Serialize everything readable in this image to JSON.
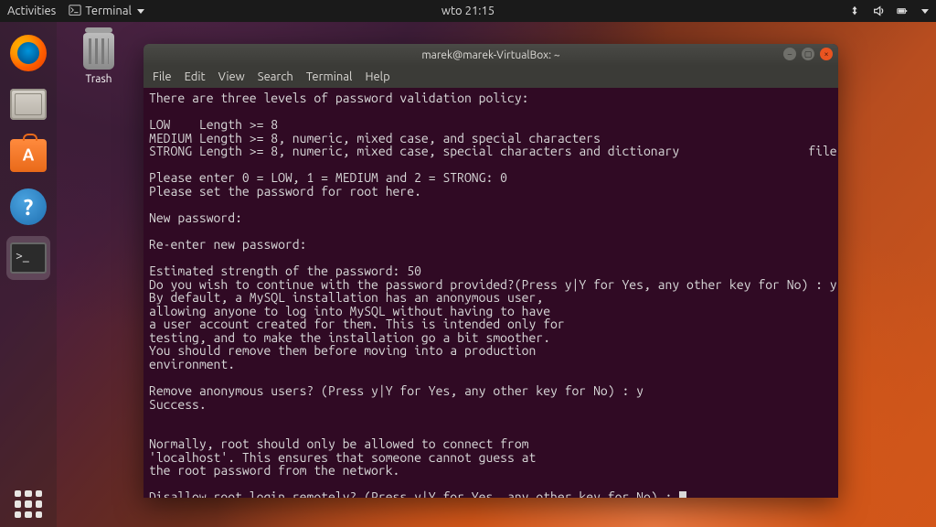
{
  "topbar": {
    "activities": "Activities",
    "app_indicator": "Terminal",
    "clock": "wto 21:15"
  },
  "desktop": {
    "trash_label": "Trash"
  },
  "launcher": {
    "items": [
      "firefox",
      "files",
      "software",
      "help",
      "terminal"
    ]
  },
  "window": {
    "title": "marek@marek-VirtualBox: ~",
    "menus": {
      "file": "File",
      "edit": "Edit",
      "view": "View",
      "search": "Search",
      "terminal": "Terminal",
      "help": "Help"
    }
  },
  "terminal_lines": [
    "There are three levels of password validation policy:",
    "",
    "LOW    Length >= 8",
    "MEDIUM Length >= 8, numeric, mixed case, and special characters",
    "STRONG Length >= 8, numeric, mixed case, special characters and dictionary                  file",
    "",
    "Please enter 0 = LOW, 1 = MEDIUM and 2 = STRONG: 0",
    "Please set the password for root here.",
    "",
    "New password:",
    "",
    "Re-enter new password:",
    "",
    "Estimated strength of the password: 50",
    "Do you wish to continue with the password provided?(Press y|Y for Yes, any other key for No) : y",
    "By default, a MySQL installation has an anonymous user,",
    "allowing anyone to log into MySQL without having to have",
    "a user account created for them. This is intended only for",
    "testing, and to make the installation go a bit smoother.",
    "You should remove them before moving into a production",
    "environment.",
    "",
    "Remove anonymous users? (Press y|Y for Yes, any other key for No) : y",
    "Success.",
    "",
    "",
    "Normally, root should only be allowed to connect from",
    "'localhost'. This ensures that someone cannot guess at",
    "the root password from the network.",
    "",
    "Disallow root login remotely? (Press y|Y for Yes, any other key for No) : "
  ]
}
